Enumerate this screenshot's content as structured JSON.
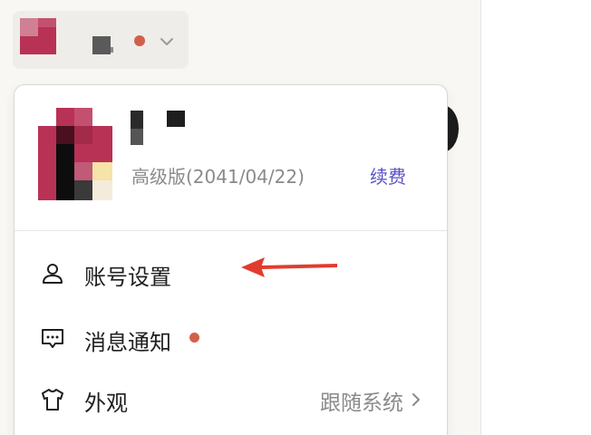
{
  "colors": {
    "accent": "#5a50c8",
    "notification_dot": "#d1604a",
    "arrow": "#e23b2e",
    "avatar_main": "#b83256"
  },
  "header": {
    "account_switcher": {
      "has_notification": true,
      "icon": "chevron-down-icon"
    }
  },
  "menu": {
    "plan": {
      "text": "高级版(2041/04/22)",
      "renew_label": "续费"
    },
    "items": [
      {
        "label": "账号设置",
        "icon": "user-icon"
      },
      {
        "label": "消息通知",
        "icon": "message-icon",
        "has_notification": true
      },
      {
        "label": "外观",
        "icon": "tshirt-icon",
        "value": "跟随系统",
        "trailing_icon": "chevron-right-icon"
      }
    ]
  },
  "annotation": {
    "icon": "red-arrow-icon",
    "points_to": "账号设置"
  }
}
